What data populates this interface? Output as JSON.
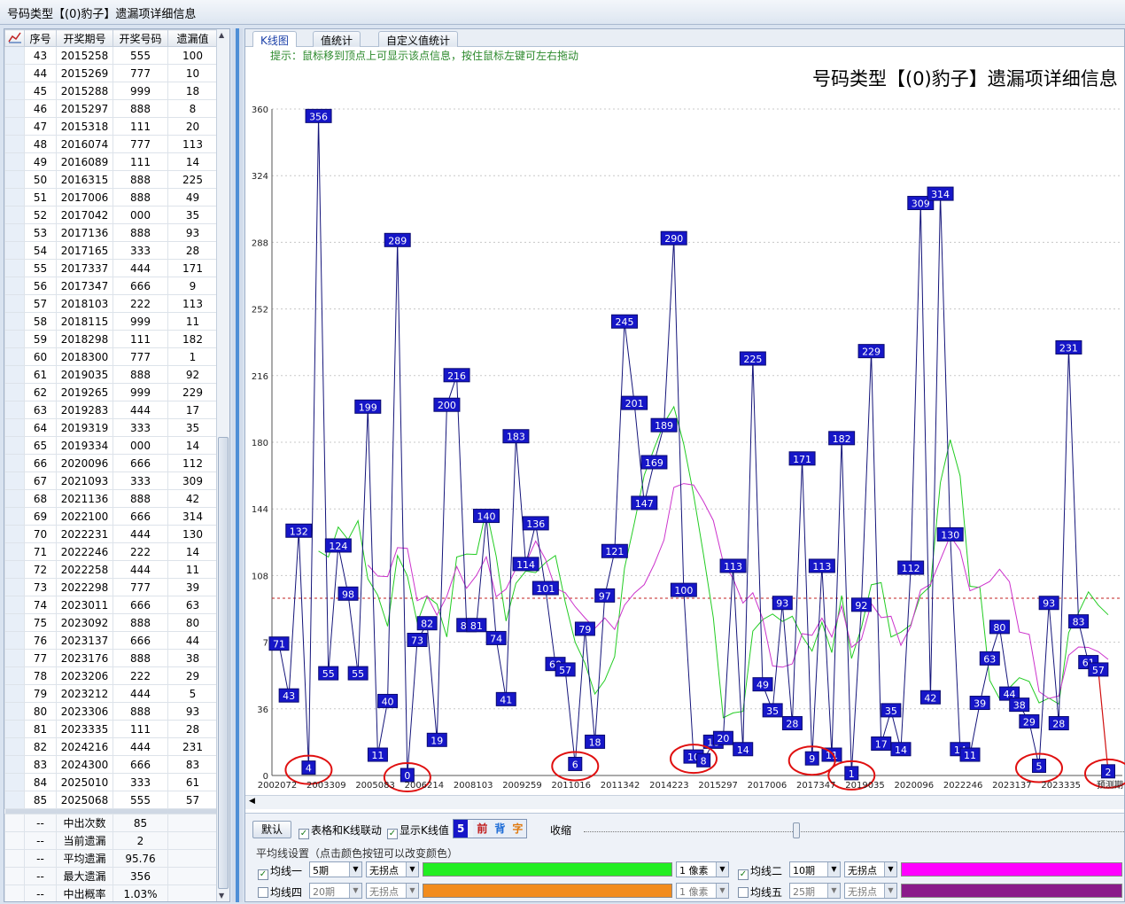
{
  "window": {
    "title": "号码类型【(0)豹子】遗漏项详细信息"
  },
  "table": {
    "headers": [
      "序号",
      "开奖期号",
      "开奖号码",
      "遗漏值"
    ],
    "rows": [
      [
        "43",
        "2015258",
        "555",
        "100"
      ],
      [
        "44",
        "2015269",
        "777",
        "10"
      ],
      [
        "45",
        "2015288",
        "999",
        "18"
      ],
      [
        "46",
        "2015297",
        "888",
        "8"
      ],
      [
        "47",
        "2015318",
        "111",
        "20"
      ],
      [
        "48",
        "2016074",
        "777",
        "113"
      ],
      [
        "49",
        "2016089",
        "111",
        "14"
      ],
      [
        "50",
        "2016315",
        "888",
        "225"
      ],
      [
        "51",
        "2017006",
        "888",
        "49"
      ],
      [
        "52",
        "2017042",
        "000",
        "35"
      ],
      [
        "53",
        "2017136",
        "888",
        "93"
      ],
      [
        "54",
        "2017165",
        "333",
        "28"
      ],
      [
        "55",
        "2017337",
        "444",
        "171"
      ],
      [
        "56",
        "2017347",
        "666",
        "9"
      ],
      [
        "57",
        "2018103",
        "222",
        "113"
      ],
      [
        "58",
        "2018115",
        "999",
        "11"
      ],
      [
        "59",
        "2018298",
        "111",
        "182"
      ],
      [
        "60",
        "2018300",
        "777",
        "1"
      ],
      [
        "61",
        "2019035",
        "888",
        "92"
      ],
      [
        "62",
        "2019265",
        "999",
        "229"
      ],
      [
        "63",
        "2019283",
        "444",
        "17"
      ],
      [
        "64",
        "2019319",
        "333",
        "35"
      ],
      [
        "65",
        "2019334",
        "000",
        "14"
      ],
      [
        "66",
        "2020096",
        "666",
        "112"
      ],
      [
        "67",
        "2021093",
        "333",
        "309"
      ],
      [
        "68",
        "2021136",
        "888",
        "42"
      ],
      [
        "69",
        "2022100",
        "666",
        "314"
      ],
      [
        "70",
        "2022231",
        "444",
        "130"
      ],
      [
        "71",
        "2022246",
        "222",
        "14"
      ],
      [
        "72",
        "2022258",
        "444",
        "11"
      ],
      [
        "73",
        "2022298",
        "777",
        "39"
      ],
      [
        "74",
        "2023011",
        "666",
        "63"
      ],
      [
        "75",
        "2023092",
        "888",
        "80"
      ],
      [
        "76",
        "2023137",
        "666",
        "44"
      ],
      [
        "77",
        "2023176",
        "888",
        "38"
      ],
      [
        "78",
        "2023206",
        "222",
        "29"
      ],
      [
        "79",
        "2023212",
        "444",
        "5"
      ],
      [
        "80",
        "2023306",
        "888",
        "93"
      ],
      [
        "81",
        "2023335",
        "111",
        "28"
      ],
      [
        "82",
        "2024216",
        "444",
        "231"
      ],
      [
        "83",
        "2024300",
        "666",
        "83"
      ],
      [
        "84",
        "2025010",
        "333",
        "61"
      ],
      [
        "85",
        "2025068",
        "555",
        "57"
      ]
    ],
    "stats": [
      [
        "--",
        "中出次数",
        "85"
      ],
      [
        "--",
        "当前遗漏",
        "2"
      ],
      [
        "--",
        "平均遗漏",
        "95.76"
      ],
      [
        "--",
        "最大遗漏",
        "356"
      ],
      [
        "--",
        "中出概率",
        "1.03%"
      ]
    ]
  },
  "tabs": [
    "K线图",
    "值统计",
    "自定义值统计"
  ],
  "hint": "提示：鼠标移到顶点上可显示该点信息，按住鼠标左键可左右拖动",
  "chart_title": "号码类型【(0)豹子】遗漏项详细信息",
  "chart_data": {
    "type": "line",
    "ylim": [
      0,
      360
    ],
    "yticks": [
      0,
      36,
      72,
      108,
      144,
      180,
      216,
      252,
      288,
      324,
      360
    ],
    "ytick_labels": [
      "0",
      "36",
      "7",
      "108",
      "144",
      "180",
      "216",
      "252",
      "288",
      "324",
      "360"
    ],
    "xtick_labels": [
      "2002072",
      "2003309",
      "2005083",
      "2006214",
      "2008103",
      "2009259",
      "2011016",
      "2011342",
      "2014223",
      "2015297",
      "2017006",
      "2017347",
      "2019035",
      "2020096",
      "2022246",
      "2023137",
      "2023335",
      "预测期"
    ],
    "average_line": 95.76,
    "values": [
      71,
      43,
      132,
      4,
      356,
      55,
      124,
      98,
      55,
      199,
      11,
      40,
      289,
      0,
      73,
      82,
      19,
      200,
      216,
      81,
      81,
      140,
      74,
      41,
      183,
      114,
      136,
      101,
      60,
      57,
      6,
      79,
      18,
      97,
      121,
      245,
      201,
      147,
      169,
      189,
      290,
      100,
      10,
      8,
      18,
      20,
      113,
      14,
      225,
      49,
      35,
      93,
      28,
      171,
      9,
      113,
      11,
      182,
      1,
      92,
      229,
      17,
      35,
      14,
      112,
      309,
      42,
      314,
      130,
      14,
      11,
      39,
      63,
      80,
      44,
      38,
      29,
      5,
      93,
      28,
      231,
      83,
      61,
      57,
      2
    ],
    "highlighted_indices": [
      3,
      13,
      30,
      42,
      54,
      58,
      77,
      84
    ],
    "series": [
      {
        "name": "均线一",
        "color": "#22cc22"
      },
      {
        "name": "均线二",
        "color": "#cc33cc"
      }
    ]
  },
  "controls": {
    "default_button": "默认",
    "link_checkbox": "表格和K线联动",
    "show_value_checkbox": "显示K线值",
    "badge_number": "5",
    "badge_front": "前",
    "badge_back": "背",
    "badge_font": "字",
    "shrink_label": "收缩",
    "ma_settings_label": "平均线设置（点击颜色按钮可以改变颜色）",
    "ma_lines": [
      {
        "name": "均线一",
        "period": "5期",
        "inflection": "无拐点",
        "color": "#22ee22",
        "width": "1 像素",
        "checked": true
      },
      {
        "name": "均线二",
        "period": "10期",
        "inflection": "无拐点",
        "color": "#ff00ff",
        "checked": true
      },
      {
        "name": "均线四",
        "period": "20期",
        "inflection": "无拐点",
        "color": "#f28c1e",
        "width": "1 像素",
        "checked": false
      },
      {
        "name": "均线五",
        "period": "25期",
        "inflection": "无拐点",
        "color": "#8a1a8a",
        "checked": false
      }
    ]
  }
}
